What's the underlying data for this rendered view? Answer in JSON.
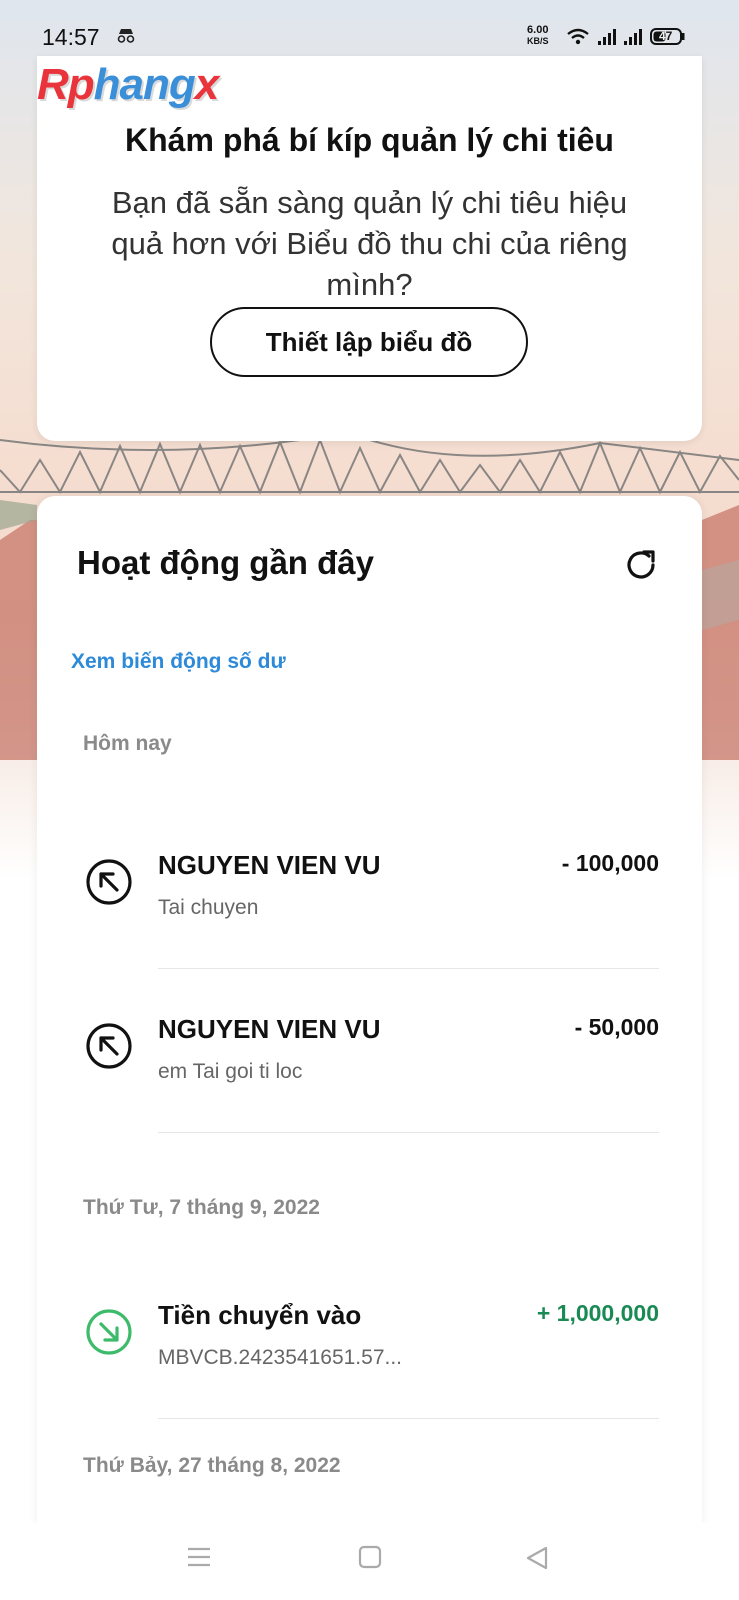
{
  "status_bar": {
    "time": "14:57",
    "net_speed_value": "6.00",
    "net_speed_unit": "KB/S",
    "battery": "47"
  },
  "watermark": {
    "part1": "Rp",
    "part2": "hang",
    "part3": "x"
  },
  "promo_card": {
    "title": "Khám phá bí kíp quản lý chi tiêu",
    "description": "Bạn đã sẵn sàng quản lý chi tiêu hiệu quả hơn với Biểu đồ thu chi của riêng mình?",
    "button_label": "Thiết lập biểu đồ"
  },
  "activity": {
    "title": "Hoạt động gần đây",
    "balance_link": "Xem biến động số dư",
    "groups": [
      {
        "date": "Hôm nay",
        "transactions": [
          {
            "name": "NGUYEN VIEN VU",
            "desc": "Tai chuyen",
            "amount": "- 100,000",
            "direction": "out"
          },
          {
            "name": "NGUYEN VIEN VU",
            "desc": "em Tai goi ti loc",
            "amount": "- 50,000",
            "direction": "out"
          }
        ]
      },
      {
        "date": "Thứ Tư, 7 tháng 9, 2022",
        "transactions": [
          {
            "name": "Tiền chuyển vào",
            "desc": "MBVCB.2423541651.57...",
            "amount": "+ 1,000,000",
            "direction": "in"
          }
        ]
      },
      {
        "date": "Thứ Bảy, 27 tháng 8, 2022",
        "transactions": []
      }
    ]
  },
  "colors": {
    "link": "#2d8ad8",
    "incoming": "#1a8a55",
    "incoming_icon": "#3dbb6a",
    "text_primary": "#111111",
    "text_muted": "#8a8a8a"
  }
}
